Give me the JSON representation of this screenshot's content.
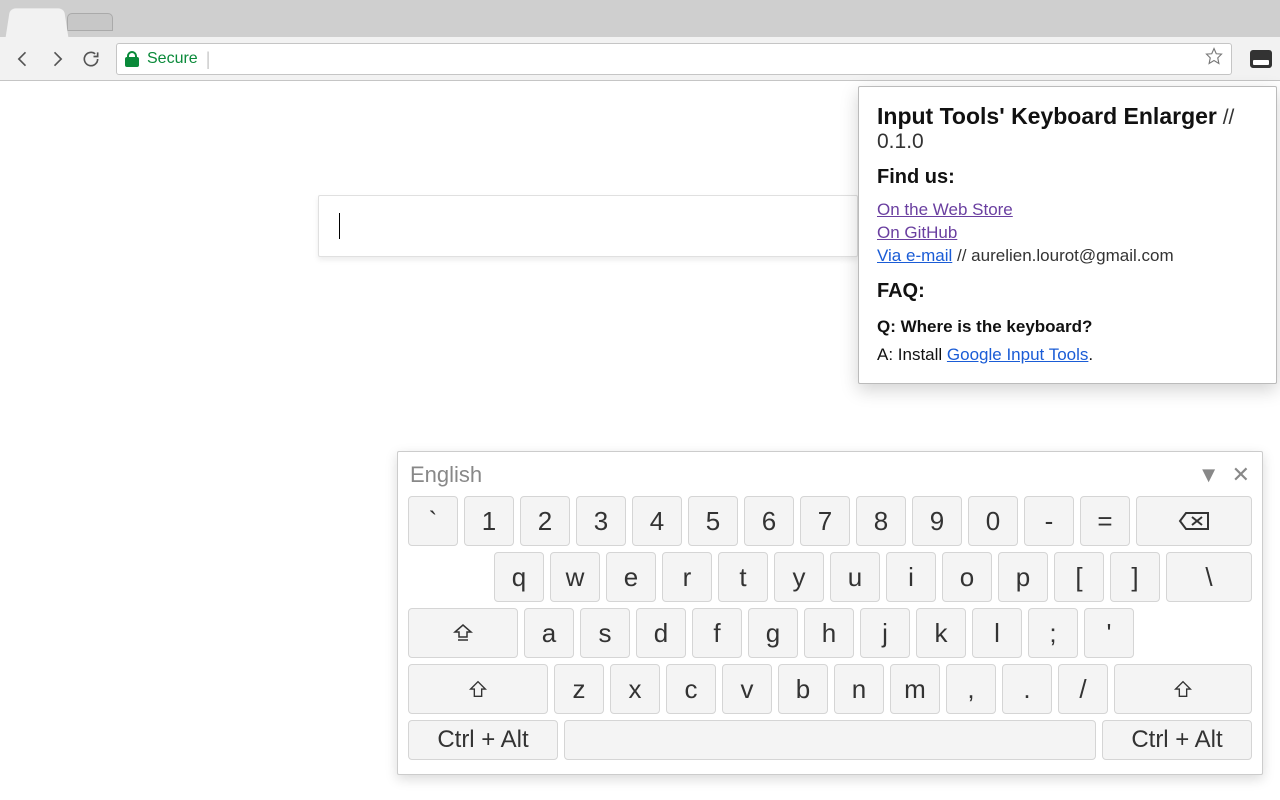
{
  "browser": {
    "secure_label": "Secure"
  },
  "popup": {
    "title": "Input Tools' Keyboard Enlarger",
    "version_prefix": " // ",
    "version": "0.1.0",
    "find_us": "Find us:",
    "links": {
      "webstore": "On the Web Store",
      "github": "On GitHub",
      "email": "Via e-mail",
      "email_suffix": " // aurelien.lourot@gmail.com"
    },
    "faq": "FAQ:",
    "q1": "Q: Where is the keyboard?",
    "a1_prefix": "A: Install ",
    "a1_link": "Google Input Tools",
    "a1_suffix": "."
  },
  "keyboard": {
    "language": "English",
    "rows": {
      "r1": [
        "`",
        "1",
        "2",
        "3",
        "4",
        "5",
        "6",
        "7",
        "8",
        "9",
        "0",
        "-",
        "="
      ],
      "r2": [
        "q",
        "w",
        "e",
        "r",
        "t",
        "y",
        "u",
        "i",
        "o",
        "p",
        "[",
        "]",
        "\\"
      ],
      "r3": [
        "a",
        "s",
        "d",
        "f",
        "g",
        "h",
        "j",
        "k",
        "l",
        ";",
        "'"
      ],
      "r4": [
        "z",
        "x",
        "c",
        "v",
        "b",
        "n",
        "m",
        ",",
        ".",
        "/"
      ]
    },
    "ctrl_alt": "Ctrl + Alt",
    "dropdown_glyph": "▼",
    "close_glyph": "✕"
  }
}
